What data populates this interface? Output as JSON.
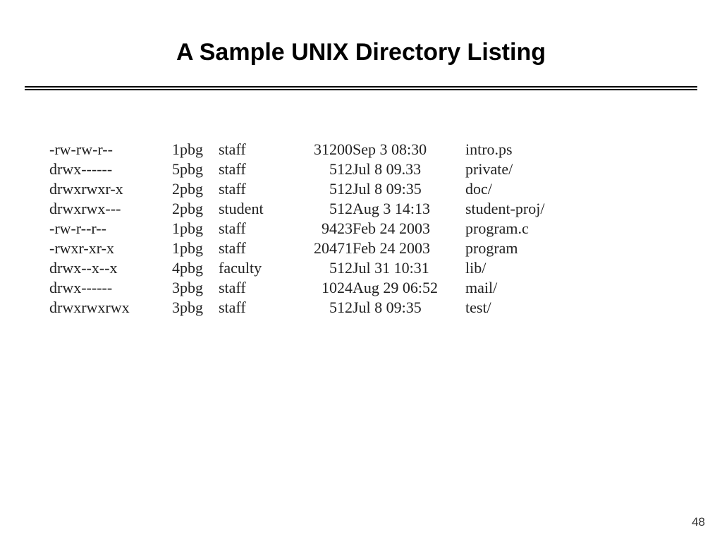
{
  "title": "A Sample UNIX Directory Listing",
  "page_number": "48",
  "rows": [
    {
      "perms": "-rw-rw-r--",
      "links": "1",
      "owner": "pbg",
      "group": "staff",
      "size": "31200",
      "date": "Sep 3 08:30",
      "name": "intro.ps"
    },
    {
      "perms": "drwx------",
      "links": "5",
      "owner": "pbg",
      "group": "staff",
      "size": "512",
      "date": "Jul 8 09.33",
      "name": "private/"
    },
    {
      "perms": "drwxrwxr-x",
      "links": "2",
      "owner": "pbg",
      "group": "staff",
      "size": "512",
      "date": "Jul 8 09:35",
      "name": "doc/"
    },
    {
      "perms": "drwxrwx---",
      "links": "2",
      "owner": "pbg",
      "group": "student",
      "size": "512",
      "date": "Aug 3 14:13",
      "name": "student-proj/"
    },
    {
      "perms": "-rw-r--r--",
      "links": "1",
      "owner": "pbg",
      "group": "staff",
      "size": "9423",
      "date": "Feb 24 2003",
      "name": "program.c"
    },
    {
      "perms": "-rwxr-xr-x",
      "links": "1",
      "owner": "pbg",
      "group": "staff",
      "size": "20471",
      "date": "Feb 24 2003",
      "name": "program"
    },
    {
      "perms": "drwx--x--x",
      "links": "4",
      "owner": "pbg",
      "group": "faculty",
      "size": "512",
      "date": "Jul 31 10:31",
      "name": "lib/"
    },
    {
      "perms": "drwx------",
      "links": "3",
      "owner": "pbg",
      "group": "staff",
      "size": "1024",
      "date": "Aug 29 06:52",
      "name": "mail/"
    },
    {
      "perms": "drwxrwxrwx",
      "links": "3",
      "owner": "pbg",
      "group": "staff",
      "size": "512",
      "date": "Jul 8 09:35",
      "name": "test/"
    }
  ]
}
